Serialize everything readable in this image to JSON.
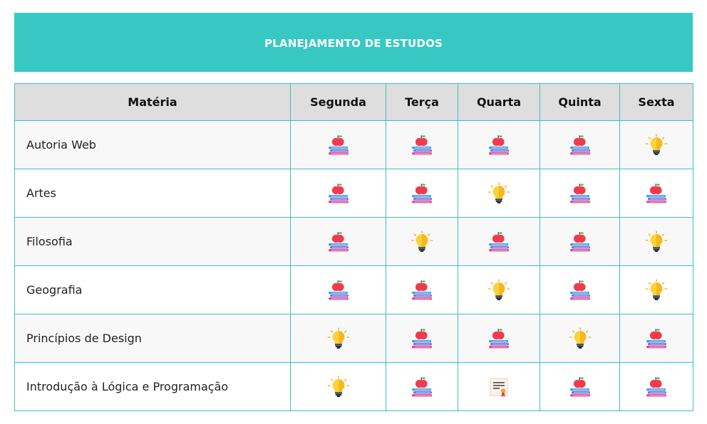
{
  "header": {
    "title": "PLANEJAMENTO DE ESTUDOS",
    "background_color": "#37c8c4"
  },
  "table": {
    "columns": [
      "Matéria",
      "Segunda",
      "Terça",
      "Quarta",
      "Quinta",
      "Sexta"
    ],
    "rows": [
      {
        "subject": "Autoria Web",
        "days": [
          "books-apple-icon",
          "books-apple-icon",
          "books-apple-icon",
          "books-apple-icon",
          "lightbulb-icon"
        ]
      },
      {
        "subject": "Artes",
        "days": [
          "books-apple-icon",
          "books-apple-icon",
          "lightbulb-icon",
          "books-apple-icon",
          "books-apple-icon"
        ]
      },
      {
        "subject": "Filosofia",
        "days": [
          "books-apple-icon",
          "lightbulb-icon",
          "books-apple-icon",
          "books-apple-icon",
          "lightbulb-icon"
        ]
      },
      {
        "subject": "Geografia",
        "days": [
          "books-apple-icon",
          "books-apple-icon",
          "lightbulb-icon",
          "books-apple-icon",
          "lightbulb-icon"
        ]
      },
      {
        "subject": "Princípios de Design",
        "days": [
          "lightbulb-icon",
          "books-apple-icon",
          "books-apple-icon",
          "lightbulb-icon",
          "books-apple-icon"
        ]
      },
      {
        "subject": "Introdução à Lógica e Programação",
        "days": [
          "lightbulb-icon",
          "books-apple-icon",
          "certificate-icon",
          "books-apple-icon",
          "books-apple-icon"
        ]
      }
    ],
    "border_color": "#3dbfc7",
    "header_background": "#dedede"
  }
}
